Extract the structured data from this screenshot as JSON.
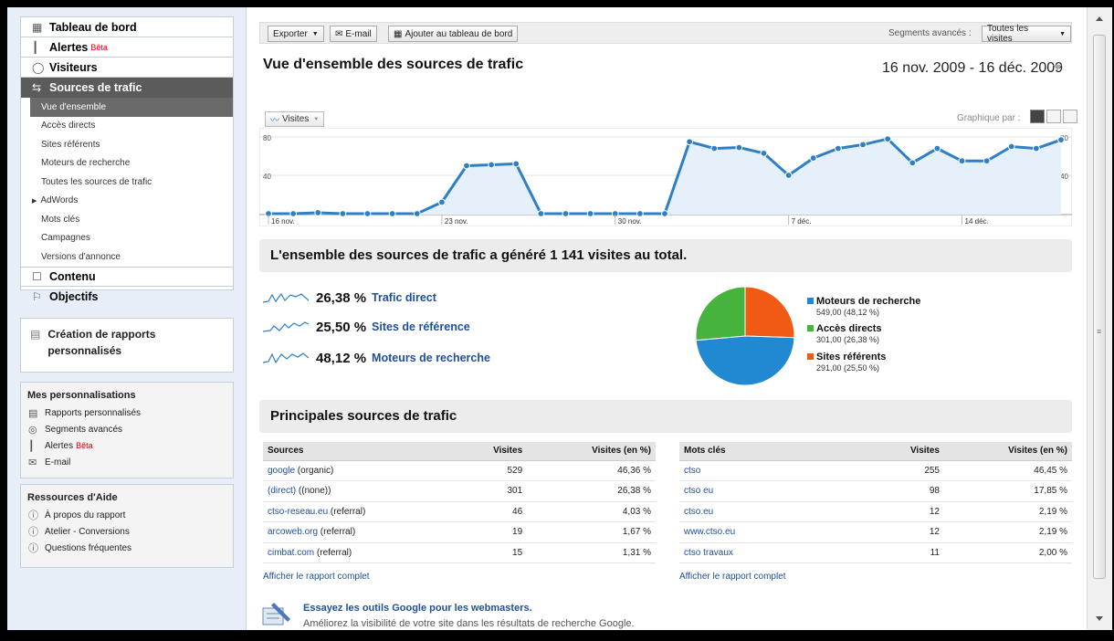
{
  "sidebar": {
    "nav": [
      {
        "label": "Tableau de bord",
        "icon": "dashboard-icon"
      },
      {
        "label": "Alertes",
        "icon": "alert-chart-icon",
        "badge": "Bêta"
      },
      {
        "label": "Visiteurs",
        "icon": "person-icon"
      },
      {
        "label": "Sources de trafic",
        "icon": "traffic-arrows-icon"
      }
    ],
    "sub_items": [
      "Vue d'ensemble",
      "Accès directs",
      "Sites référents",
      "Moteurs de recherche",
      "Toutes les sources de trafic",
      "AdWords",
      "Mots clés",
      "Campagnes",
      "Versions d'annonce"
    ],
    "nav_bottom": [
      {
        "label": "Contenu",
        "icon": "content-icon"
      },
      {
        "label": "Objectifs",
        "icon": "flag-icon"
      }
    ],
    "custom_reports": "Création de rapports personnalisés",
    "mes_title": "Mes personnalisations",
    "mes_links": [
      {
        "label": "Rapports personnalisés",
        "icon": "report-icon"
      },
      {
        "label": "Segments avancés",
        "icon": "segment-icon"
      },
      {
        "label": "Alertes",
        "icon": "alert-chart-icon",
        "badge": "Bêta"
      },
      {
        "label": "E-mail",
        "icon": "mail-icon"
      }
    ],
    "help_title": "Ressources d'Aide",
    "help_links": [
      "À propos du rapport",
      "Atelier - Conversions",
      "Questions fréquentes"
    ]
  },
  "toolbar": {
    "export": "Exporter",
    "email": "E-mail",
    "add_dashboard": "Ajouter au tableau de bord",
    "segments_label": "Segments avancés :",
    "segments_value": "Toutes les visites"
  },
  "page_title": "Vue d'ensemble des sources de trafic",
  "date_range": "16 nov. 2009 - 16 déc. 2009",
  "graph_by": "Graphique par :",
  "metric_button": "Visites",
  "chart_data": {
    "type": "area",
    "series": [
      {
        "name": "Visites",
        "values": [
          0,
          0,
          1,
          0,
          0,
          0,
          0,
          12,
          50,
          51,
          52,
          0,
          0,
          0,
          0,
          0,
          0,
          75,
          68,
          69,
          63,
          40,
          58,
          68,
          72,
          78,
          53,
          68,
          55,
          55,
          70,
          68,
          77
        ]
      }
    ],
    "ylim": [
      0,
      80
    ],
    "ytick_labels": [
      "80",
      "40"
    ],
    "xtick_labels": [
      "16 nov.",
      "23 nov.",
      "30 nov.",
      "7 déc.",
      "14 déc."
    ],
    "xtick_positions": [
      0,
      7,
      14,
      21,
      28
    ],
    "grid": true,
    "color": "#2e7fc6"
  },
  "summary": "L'ensemble des sources de trafic a généré 1 141 visites au total.",
  "sources": [
    {
      "pct": "26,38 %",
      "label": "Trafic direct"
    },
    {
      "pct": "25,50 %",
      "label": "Sites de référence"
    },
    {
      "pct": "48,12 %",
      "label": "Moteurs de recherche"
    }
  ],
  "pie_chart_data": {
    "type": "pie",
    "slices": [
      {
        "name": "Moteurs de recherche",
        "value": 549.0,
        "text": "549,00 (48,12 %)",
        "color": "#2189d2"
      },
      {
        "name": "Accès directs",
        "value": 301.0,
        "text": "301,00 (26,38 %)",
        "color": "#46b43c"
      },
      {
        "name": "Sites référents",
        "value": 291.0,
        "text": "291,00 (25,50 %)",
        "color": "#f05a14"
      }
    ]
  },
  "top_sources_title": "Principales sources de trafic",
  "sources_table": {
    "headers": [
      "Sources",
      "Visites",
      "Visites (en %)"
    ],
    "rows": [
      {
        "link": "google",
        "rest": " (organic)",
        "visits": "529",
        "pct": "46,36 %"
      },
      {
        "link": "(direct)",
        "rest": " ((none))",
        "visits": "301",
        "pct": "26,38 %"
      },
      {
        "link": "ctso-reseau.eu",
        "rest": " (referral)",
        "visits": "46",
        "pct": "4,03 %"
      },
      {
        "link": "arcoweb.org",
        "rest": " (referral)",
        "visits": "19",
        "pct": "1,67 %"
      },
      {
        "link": "cimbat.com",
        "rest": " (referral)",
        "visits": "15",
        "pct": "1,31 %"
      }
    ],
    "full_link": "Afficher le rapport complet"
  },
  "keywords_table": {
    "headers": [
      "Mots clés",
      "Visites",
      "Visites (en %)"
    ],
    "rows": [
      {
        "link": "ctso",
        "visits": "255",
        "pct": "46,45 %"
      },
      {
        "link": "ctso eu",
        "visits": "98",
        "pct": "17,85 %"
      },
      {
        "link": "ctso.eu",
        "visits": "12",
        "pct": "2,19 %"
      },
      {
        "link": "www.ctso.eu",
        "visits": "12",
        "pct": "2,19 %"
      },
      {
        "link": "ctso travaux",
        "visits": "11",
        "pct": "2,00 %"
      }
    ],
    "full_link": "Afficher le rapport complet"
  },
  "webmaster": {
    "title": "Essayez les outils Google pour les webmasters.",
    "text": "Améliorez la visibilité de votre site dans les résultats de recherche Google."
  }
}
